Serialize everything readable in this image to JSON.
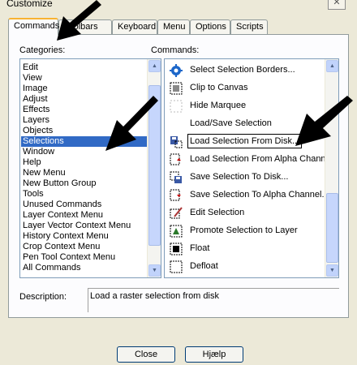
{
  "window": {
    "title": "Customize",
    "close_glyph": "✕"
  },
  "tabs": [
    {
      "label": "Commands",
      "active": true
    },
    {
      "label": "Toolbars",
      "active": false
    },
    {
      "label": "Keyboard",
      "active": false
    },
    {
      "label": "Menu",
      "active": false
    },
    {
      "label": "Options",
      "active": false
    },
    {
      "label": "Scripts",
      "active": false
    }
  ],
  "categories": {
    "label": "Categories:",
    "items": [
      "Edit",
      "View",
      "Image",
      "Adjust",
      "Effects",
      "Layers",
      "Objects",
      "Selections",
      "Window",
      "Help",
      "New Menu",
      "New Button Group",
      "Tools",
      "Unused Commands",
      "Layer Context Menu",
      "Layer Vector Context Menu",
      "History Context Menu",
      "Crop Context Menu",
      "Pen Tool Context Menu",
      "All Commands"
    ],
    "selected": "Selections"
  },
  "commands": {
    "label": "Commands:",
    "items": [
      {
        "label": "Select Selection Borders...",
        "icon": "gear-icon"
      },
      {
        "label": "Clip to Canvas",
        "icon": "clip-canvas-icon"
      },
      {
        "label": "Hide Marquee",
        "icon": "marquee-icon"
      },
      {
        "label": "Load/Save Selection",
        "icon": ""
      },
      {
        "label": "Load Selection From Disk...",
        "icon": "load-selection-disk-icon"
      },
      {
        "label": "Load Selection From Alpha Channel...",
        "icon": "load-selection-alpha-icon"
      },
      {
        "label": "Save Selection To Disk...",
        "icon": "save-selection-disk-icon"
      },
      {
        "label": "Save Selection To Alpha Channel...",
        "icon": "save-selection-alpha-icon"
      },
      {
        "label": "Edit Selection",
        "icon": "edit-selection-icon"
      },
      {
        "label": "Promote Selection to Layer",
        "icon": "promote-selection-icon"
      },
      {
        "label": "Float",
        "icon": "float-icon"
      },
      {
        "label": "Defloat",
        "icon": "defloat-icon"
      }
    ],
    "focused": "Load Selection From Disk..."
  },
  "description": {
    "label": "Description:",
    "text": "Load a raster selection from disk"
  },
  "buttons": {
    "close": "Close",
    "help": "Hjælp"
  },
  "colors": {
    "selection": "#316ac5",
    "tab_accent": "#f8b332",
    "panel_bg": "#ece9d8"
  }
}
